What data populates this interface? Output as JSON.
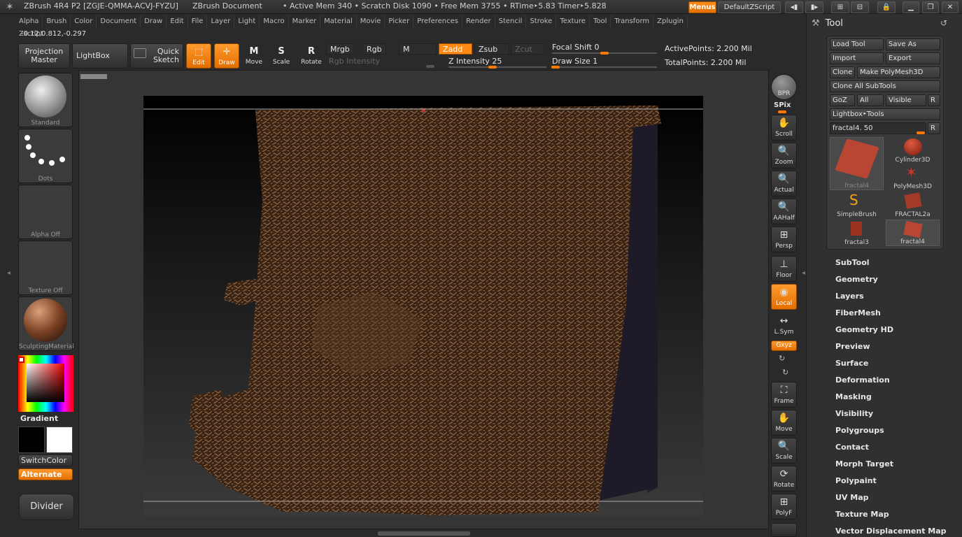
{
  "titlebar": {
    "app": "ZBrush 4R4 P2 [ZGJE-QMMA-ACVJ-FYZU]",
    "document": "ZBrush Document",
    "stats": "• Active Mem 340 • Scratch Disk 1090 • Free Mem 3755 • RTime‣5.83 Timer‣5.828",
    "menus_btn": "Menus",
    "script_btn": "DefaultZScript"
  },
  "menubar": [
    "Alpha",
    "Brush",
    "Color",
    "Document",
    "Draw",
    "Edit",
    "File",
    "Layer",
    "Light",
    "Macro",
    "Marker",
    "Material",
    "Movie",
    "Picker",
    "Preferences",
    "Render",
    "Stencil",
    "Stroke",
    "Texture",
    "Tool",
    "Transform",
    "Zplugin",
    "Zscript"
  ],
  "coords": "-0.12,0.812,-0.297",
  "shelf": {
    "projection_master": [
      "Projection",
      "Master"
    ],
    "lightbox": "LightBox",
    "quick_sketch": [
      "Quick",
      "Sketch"
    ],
    "edit": "Edit",
    "draw": "Draw",
    "move": "Move",
    "scale": "Scale",
    "rotate": "Rotate",
    "mrgb": "Mrgb",
    "rgb": "Rgb",
    "m": "M",
    "zadd": "Zadd",
    "zsub": "Zsub",
    "zcut": "Zcut",
    "rgb_intensity": "Rgb Intensity",
    "z_intensity": "Z Intensity 25",
    "focal_shift": "Focal Shift",
    "focal_shift_value": "0",
    "draw_size": "Draw Size 1",
    "active_points": "ActivePoints: 2.200 Mil",
    "total_points": "TotalPoints: 2.200 Mil"
  },
  "left": {
    "standard": "Standard",
    "dots": "Dots",
    "alpha_off": "Alpha Off",
    "texture_off": "Texture Off",
    "material": "SculptingMaterial",
    "gradient": "Gradient",
    "switchcolor": "SwitchColor",
    "alternate": "Alternate",
    "divider": "Divider"
  },
  "right_shelf": {
    "bpr": "BPR",
    "spix": "SPix",
    "scroll": "Scroll",
    "zoom": "Zoom",
    "actual": "Actual",
    "aahalf": "AAHalf",
    "persp": "Persp",
    "floor": "Floor",
    "local": "Local",
    "lsym": "L.Sym",
    "xyz": "Gxyz",
    "frame": "Frame",
    "move": "Move",
    "scale": "Scale",
    "rotate": "Rotate",
    "polyf": "PolyF"
  },
  "tool": {
    "title": "Tool",
    "load_tool": "Load Tool",
    "save_as": "Save As",
    "import": "Import",
    "export": "Export",
    "clone": "Clone",
    "make_polymesh": "Make PolyMesh3D",
    "clone_all": "Clone All SubTools",
    "goz": "GoZ",
    "all": "All",
    "visible": "Visible",
    "r": "R",
    "lightbox_tools": "Lightbox‣Tools",
    "current": "fractal4. 50",
    "thumbs": [
      "fractal4",
      "Cylinder3D",
      "PolyMesh3D",
      "SimpleBrush",
      "FRACTAL2a",
      "fractal3",
      "fractal4"
    ],
    "submenus": [
      "SubTool",
      "Geometry",
      "Layers",
      "FiberMesh",
      "Geometry HD",
      "Preview",
      "Surface",
      "Deformation",
      "Masking",
      "Visibility",
      "Polygroups",
      "Contact",
      "Morph Target",
      "Polypaint",
      "UV Map",
      "Texture Map",
      "Vector Displacement Map"
    ]
  },
  "colors": {
    "accent": "#ff8a15",
    "panel": "#303030",
    "bg": "#2a2a2a"
  }
}
